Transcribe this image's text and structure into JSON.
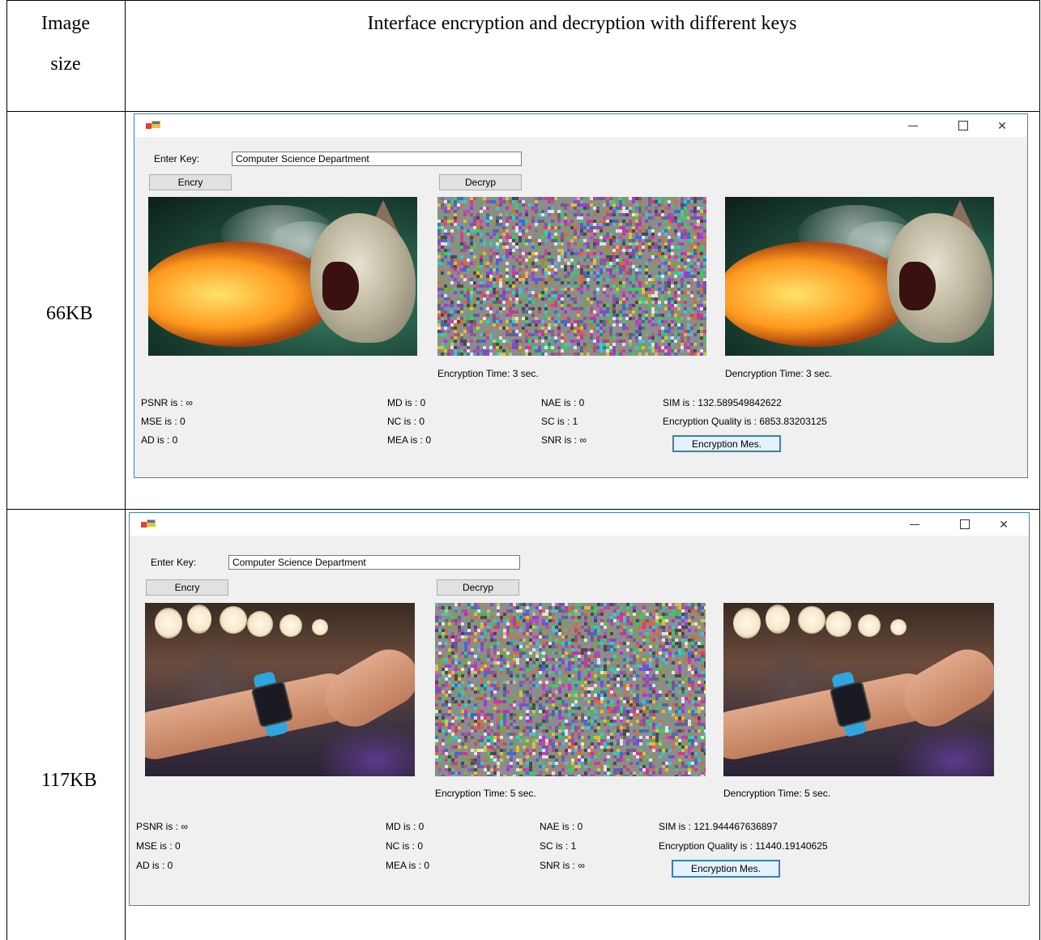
{
  "table": {
    "header_col1": [
      "Image",
      "size"
    ],
    "header_col2": "Interface encryption and decryption with different keys"
  },
  "rows": [
    {
      "size": "66KB",
      "key_label": "Enter Key:",
      "key_value": "Computer Science Department",
      "encry_button": "Encry",
      "decryp_button": "Decryp",
      "encryption_time": "Encryption Time: 3 sec.",
      "decryption_time": "Dencryption Time: 3 sec.",
      "metrics": {
        "psnr": "PSNR is : ∞",
        "mse": "MSE is : 0",
        "ad": "AD is : 0",
        "md": "MD is : 0",
        "nc": "NC is : 0",
        "mea": "MEA is : 0",
        "nae": "NAE is : 0",
        "sc": "SC is : 1",
        "snr": "SNR is : ∞",
        "sim": "SIM is : 132.589549842622",
        "quality": "Encryption Quality is : 6853.83203125"
      },
      "mes_button": "Encryption Mes."
    },
    {
      "size": "117KB",
      "key_label": "Enter Key:",
      "key_value": "Computer Science Department",
      "encry_button": "Encry",
      "decryp_button": "Decryp",
      "encryption_time": "Encryption Time: 5 sec.",
      "decryption_time": "Dencryption Time: 5 sec.",
      "metrics": {
        "psnr": "PSNR is : ∞",
        "mse": "MSE is : 0",
        "ad": "AD is : 0",
        "md": "MD is : 0",
        "nc": "NC is : 0",
        "mea": "MEA is : 0",
        "nae": "NAE is : 0",
        "sc": "SC is : 1",
        "snr": "SNR is : ∞",
        "sim": "SIM is : 121.944467636897",
        "quality": "Encryption Quality is : 11440.19140625"
      },
      "mes_button": "Encryption Mes."
    }
  ],
  "window_controls": {
    "minimize": "minimize-icon",
    "maximize": "maximize-icon",
    "close": "✕"
  },
  "colors": {
    "window_border": "#3a87c8",
    "window_bg": "#f0f0f0"
  }
}
